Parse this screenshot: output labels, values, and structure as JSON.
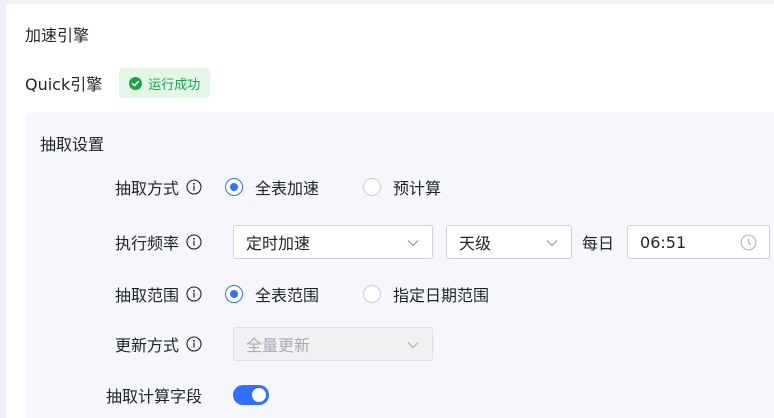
{
  "section_title": "加速引擎",
  "engine": {
    "name": "Quick引擎",
    "status": "运行成功"
  },
  "panel": {
    "title": "抽取设置",
    "extract_mode": {
      "label": "抽取方式",
      "options": [
        "全表加速",
        "预计算"
      ],
      "selected": "全表加速"
    },
    "frequency": {
      "label": "执行频率",
      "mode_value": "定时加速",
      "level_value": "天级",
      "every_label": "每日",
      "time_value": "06:51"
    },
    "extract_range": {
      "label": "抽取范围",
      "options": [
        "全表范围",
        "指定日期范围"
      ],
      "selected": "全表范围"
    },
    "update_mode": {
      "label": "更新方式",
      "value": "全量更新",
      "disabled": true
    },
    "calc_fields": {
      "label": "抽取计算字段",
      "enabled": true
    }
  },
  "colors": {
    "accent": "#3370ff",
    "success_text": "#1aa34a",
    "success_bg": "#e3f6e8",
    "panel_bg": "#f5f7fa"
  }
}
